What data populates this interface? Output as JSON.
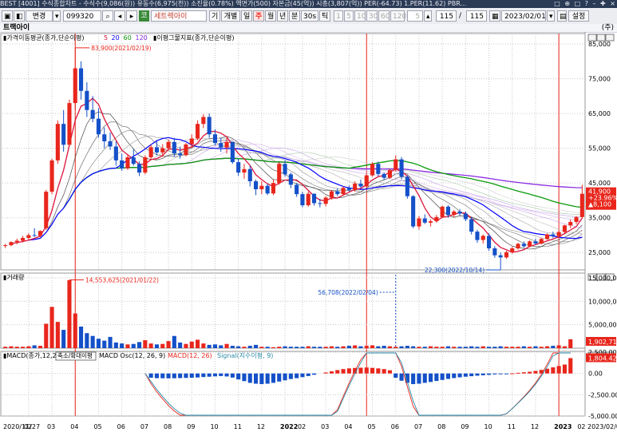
{
  "titlebar": {
    "text": "BEST [4001] 수식종합차트 - 수식수(9,086(원)) 유동수(6,975(천)) 소진율(0.78%) 액면가(500) 자본금(45(억)) 시총(3,807(억)) PER(-64.73) 1.PER(11.62) PBR...",
    "buttons": [
      "□",
      "⊕",
      "□",
      "?",
      "–",
      "✚",
      "×"
    ]
  },
  "toolbar": {
    "view_label": "변경",
    "code": "099320",
    "stock_name": "세트렉아이",
    "buttons": [
      "기",
      "개별",
      "일",
      "주",
      "월",
      "년",
      "분",
      "30s",
      "틱"
    ],
    "period_buttons": [
      "1",
      "5",
      "10",
      "30",
      "60",
      "120"
    ],
    "interval_value": "5",
    "count": "115",
    "count_total": "115",
    "date": "2023/02/01",
    "settings_label": "설정"
  },
  "subbar": {
    "title": "트랙아이",
    "right_label": "(주)"
  },
  "legends": {
    "price": "가격이동평균(종가,단순이평)",
    "ma_periods": [
      "5",
      "20",
      "60",
      "120"
    ],
    "ma_colors": [
      "#dc143c",
      "#0000ff",
      "#0a9a0a",
      "#8a2be2"
    ],
    "price2": "이평그물지표(종가,단순이평)",
    "volume": "거래량",
    "macd_prefix": "MACD(종가,12,26,9)",
    "macd_osc": "MACD Osc(12, 26, 9)",
    "macd_line": "MACD(12, 26)",
    "macd_signal": "Signal(지수이평, 9)",
    "popup_text": "축소/확대이평"
  },
  "price_axis": [
    "85,000",
    "75,000",
    "65,000",
    "55,000",
    "45,000",
    "35,000",
    "25,000"
  ],
  "volume_axis": [
    "15,000,000",
    "10,000,000",
    "5,000,000"
  ],
  "macd_axis": [
    "2,500.00",
    "0.00",
    "-2,500.00",
    "-5,000.00"
  ],
  "x_axis": [
    "2020/11/27",
    "02",
    "03",
    "04",
    "05",
    "06",
    "07",
    "08",
    "09",
    "10",
    "11",
    "12",
    "2022",
    "02",
    "03",
    "04",
    "05",
    "06",
    "07",
    "08",
    "09",
    "10",
    "11",
    "12",
    "2023",
    "02",
    "2023/02/01"
  ],
  "annotations": {
    "high": "83,900(2021/02/19)",
    "low": "22,300(2022/10/14)",
    "vol_high": "14,553,625(2021/01/22)",
    "vol_mark": "56,708(2022/02/04)"
  },
  "current": {
    "price": "41,900",
    "pct": "+23.96%",
    "change": "▲8,100",
    "volume": "1,902,714",
    "macd": "1,804.42"
  },
  "colors": {
    "up": "#e8261c",
    "down": "#1450c8",
    "accent": "#e8261c",
    "bg": "#ffffff",
    "grid": "#c8c8c8"
  },
  "chart_data": {
    "type": "candlestick",
    "price_weekly": [
      [
        27000,
        27500,
        26300,
        27100
      ],
      [
        27100,
        28200,
        26800,
        28000
      ],
      [
        28000,
        29000,
        27400,
        28400
      ],
      [
        28400,
        29800,
        27900,
        29200
      ],
      [
        29200,
        30500,
        28600,
        30000
      ],
      [
        30000,
        32000,
        29500,
        29800
      ],
      [
        29800,
        31400,
        29400,
        31200
      ],
      [
        32000,
        43000,
        31500,
        42500
      ],
      [
        42500,
        52000,
        41800,
        51500
      ],
      [
        51500,
        63000,
        50500,
        62000
      ],
      [
        62000,
        66000,
        54000,
        56000
      ],
      [
        56000,
        69000,
        55500,
        68000
      ],
      [
        68000,
        83900,
        66000,
        78000
      ],
      [
        78000,
        80000,
        69000,
        71500
      ],
      [
        71500,
        74000,
        64000,
        66000
      ],
      [
        66000,
        70000,
        62500,
        63500
      ],
      [
        63500,
        66500,
        58000,
        59000
      ],
      [
        59000,
        61000,
        55000,
        57000
      ],
      [
        57000,
        59500,
        54500,
        55500
      ],
      [
        55500,
        57000,
        50000,
        51500
      ],
      [
        51500,
        53500,
        48500,
        49200
      ],
      [
        49200,
        53000,
        48800,
        52400
      ],
      [
        52400,
        54800,
        50000,
        50500
      ],
      [
        50500,
        51200,
        47000,
        48000
      ],
      [
        48000,
        53000,
        47500,
        52400
      ],
      [
        52400,
        56000,
        51800,
        55300
      ],
      [
        55300,
        57000,
        53000,
        53800
      ],
      [
        53800,
        56200,
        52500,
        55000
      ],
      [
        55000,
        57500,
        54500,
        56800
      ],
      [
        56800,
        58000,
        52500,
        53500
      ],
      [
        53500,
        55500,
        52000,
        53000
      ],
      [
        53000,
        56500,
        52700,
        56100
      ],
      [
        56100,
        59000,
        55000,
        57800
      ],
      [
        57800,
        63000,
        57300,
        62000
      ],
      [
        62000,
        64800,
        60800,
        64000
      ],
      [
        64000,
        65000,
        58000,
        59000
      ],
      [
        59000,
        60500,
        55800,
        56500
      ],
      [
        56500,
        58000,
        54000,
        55200
      ],
      [
        55200,
        58000,
        53500,
        56800
      ],
      [
        56800,
        56200,
        50500,
        51000
      ],
      [
        51000,
        52000,
        47000,
        48000
      ],
      [
        48000,
        50500,
        46200,
        49000
      ],
      [
        49000,
        50000,
        44000,
        45500
      ],
      [
        45500,
        46000,
        41500,
        43200
      ],
      [
        43200,
        45500,
        41800,
        44200
      ],
      [
        44200,
        44800,
        41500,
        42000
      ],
      [
        42000,
        46000,
        41500,
        45000
      ],
      [
        45000,
        51000,
        44500,
        50500
      ],
      [
        50500,
        51500,
        46800,
        47500
      ],
      [
        47500,
        48000,
        43500,
        44500
      ],
      [
        44500,
        45000,
        41000,
        41800
      ],
      [
        41800,
        42500,
        38000,
        38600
      ],
      [
        38600,
        42500,
        38200,
        41900
      ],
      [
        41900,
        42000,
        38500,
        39200
      ],
      [
        39200,
        40500,
        38000,
        39000
      ],
      [
        39000,
        41200,
        38300,
        40800
      ],
      [
        40800,
        43000,
        40200,
        42600
      ],
      [
        42600,
        43500,
        41200,
        41800
      ],
      [
        41800,
        44000,
        41300,
        43600
      ],
      [
        43600,
        44300,
        42500,
        43000
      ],
      [
        43000,
        45500,
        42500,
        44800
      ],
      [
        44800,
        46000,
        43500,
        44000
      ],
      [
        44000,
        47500,
        43800,
        47200
      ],
      [
        47200,
        51000,
        46800,
        50500
      ],
      [
        50500,
        51200,
        47000,
        47600
      ],
      [
        47600,
        48000,
        45800,
        46500
      ],
      [
        46500,
        49000,
        46200,
        48700
      ],
      [
        48700,
        53000,
        48300,
        51800
      ],
      [
        51800,
        52500,
        46000,
        46800
      ],
      [
        46800,
        47200,
        40500,
        41200
      ],
      [
        41200,
        41500,
        32000,
        32500
      ],
      [
        32500,
        35500,
        31600,
        34800
      ],
      [
        34800,
        36000,
        33200,
        33600
      ],
      [
        33600,
        34500,
        32500,
        34000
      ],
      [
        34000,
        35800,
        33600,
        35200
      ],
      [
        35200,
        38500,
        35000,
        38200
      ],
      [
        38200,
        38600,
        35000,
        35800
      ],
      [
        35800,
        37200,
        35200,
        36800
      ],
      [
        36800,
        37500,
        35600,
        36200
      ],
      [
        36200,
        36800,
        34000,
        34600
      ],
      [
        34600,
        35200,
        30200,
        31000
      ],
      [
        31000,
        31500,
        27800,
        28600
      ],
      [
        28600,
        30200,
        27600,
        29800
      ],
      [
        29800,
        30500,
        25500,
        26200
      ],
      [
        26200,
        26800,
        23500,
        24200
      ],
      [
        24200,
        25000,
        22300,
        23600
      ],
      [
        23600,
        25500,
        23200,
        25100
      ],
      [
        25100,
        26600,
        24700,
        26200
      ],
      [
        26200,
        27800,
        25800,
        27500
      ],
      [
        27500,
        28200,
        26400,
        26800
      ],
      [
        26800,
        28500,
        26500,
        28200
      ],
      [
        28200,
        29000,
        27200,
        27600
      ],
      [
        27600,
        29200,
        27300,
        28900
      ],
      [
        28900,
        30500,
        28600,
        30200
      ],
      [
        30200,
        31000,
        29200,
        29700
      ],
      [
        29700,
        31200,
        29400,
        30900
      ],
      [
        30900,
        33000,
        30500,
        32800
      ],
      [
        32800,
        34500,
        32000,
        33800
      ],
      [
        33800,
        35500,
        33200,
        35200
      ],
      [
        35200,
        44500,
        34800,
        41900
      ]
    ],
    "volume_weekly": [
      0.3,
      0.4,
      0.3,
      0.3,
      0.4,
      0.6,
      0.5,
      5.2,
      8.8,
      5.6,
      3.9,
      14.5,
      7.4,
      4.6,
      3.2,
      2.6,
      2.0,
      1.6,
      2.4,
      1.2,
      1.0,
      0.8,
      0.9,
      1.3,
      1.7,
      1.0,
      0.8,
      0.9,
      1.5,
      2.6,
      1.2,
      0.9,
      1.4,
      1.8,
      1.0,
      0.7,
      0.8,
      0.6,
      0.9,
      0.5,
      0.4,
      0.3,
      0.5,
      0.7,
      0.3,
      0.3,
      0.2,
      0.3,
      0.4,
      0.3,
      0.3,
      0.3,
      0.4,
      0.3,
      0.3,
      0.3,
      0.4,
      0.3,
      0.4,
      0.5,
      0.6,
      0.4,
      0.5,
      0.6,
      0.4,
      0.5,
      0.4,
      0.3,
      0.4,
      0.5,
      0.4,
      0.3,
      0.3,
      0.4,
      0.3,
      0.3,
      0.4,
      0.3,
      0.3,
      0.3,
      0.4,
      0.3,
      0.4,
      0.3,
      0.3,
      0.4,
      0.3,
      0.3,
      0.3,
      0.4,
      0.3,
      0.4,
      0.3,
      0.4,
      0.5,
      0.6,
      0.4,
      1.9
    ],
    "macd_osc_weekly": [
      0,
      0,
      0,
      0,
      0,
      0,
      0,
      0,
      0,
      0,
      0,
      0,
      0,
      0,
      0,
      0,
      0,
      0,
      0,
      0,
      0,
      0,
      0,
      0,
      0,
      -500,
      -550,
      -560,
      -570,
      -560,
      -540,
      -520,
      -500,
      -470,
      -420,
      -380,
      -340,
      -300,
      -350,
      -480,
      -700,
      -900,
      -1100,
      -1200,
      -1250,
      -1200,
      -1100,
      -950,
      -800,
      -650,
      -550,
      -430,
      -300,
      -150,
      0,
      120,
      250,
      400,
      520,
      600,
      650,
      680,
      700,
      660,
      600,
      520,
      380,
      -500,
      -850,
      -1100,
      -1250,
      -1200,
      -1100,
      -1000,
      -880,
      -760,
      -640,
      -540,
      -450,
      -380,
      -320,
      -260,
      -210,
      -160,
      -110,
      -60,
      -20,
      20,
      80,
      140,
      200,
      300,
      420,
      560,
      720,
      880,
      1050,
      1804
    ],
    "ma5_color": "#dc143c",
    "ma20_color": "#0000ff",
    "ma60_color": "#0a9a0a",
    "ma120_color": "#8a2be2",
    "red_vlines_index": [
      12,
      62,
      95
    ],
    "vmark_index": 67,
    "y_range": [
      20000,
      88000
    ],
    "volume_range": [
      0,
      16000000
    ],
    "macd_range": [
      -5000,
      2600
    ]
  }
}
